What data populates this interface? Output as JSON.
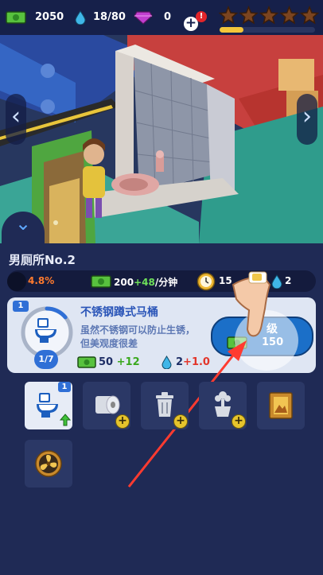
{
  "topbar": {
    "cash": "2050",
    "water": "18/80",
    "gems": "0",
    "add_symbol": "+",
    "alert_mark": "!",
    "stars_total": 5,
    "stars_earned": 0,
    "star_progress": 0.25
  },
  "scene": {
    "nav_left": "‹",
    "nav_right": "›",
    "collapse": "⌄"
  },
  "room": {
    "title": "男厕所No.2",
    "stats": {
      "percent": "4.8%",
      "income_base": "200",
      "income_bonus": "+48",
      "income_unit": "/分钟",
      "time_partial": "15",
      "water": "2"
    }
  },
  "upgrade_card": {
    "level_badge": "1",
    "progress": "1/7",
    "progress_fraction": 0.14,
    "item_name": "不锈钢蹲式马桶",
    "description_line1": "虽然不锈钢可以防止生锈，",
    "description_line2": "但美观度很差",
    "income_value": "50",
    "income_bonus": "+12",
    "water_value": "2",
    "water_bonus": "+1.0",
    "button_label_partial": "级",
    "button_cost": "150"
  },
  "items": [
    {
      "icon": "toilet-icon",
      "badge": "1",
      "selected": true
    },
    {
      "icon": "toilet-paper-icon",
      "selected": false
    },
    {
      "icon": "trash-can-icon",
      "selected": false
    },
    {
      "icon": "flower-pot-icon",
      "selected": false
    },
    {
      "icon": "picture-frame-icon",
      "selected": false
    },
    {
      "icon": "ventilation-fan-icon",
      "selected": false
    }
  ],
  "colors": {
    "panel": "#1f2a55",
    "accent_green": "#6ee05a",
    "accent_red": "#ff4d3a",
    "upgrade_button": "#1b6fc8",
    "star_empty": "#7a4420"
  }
}
